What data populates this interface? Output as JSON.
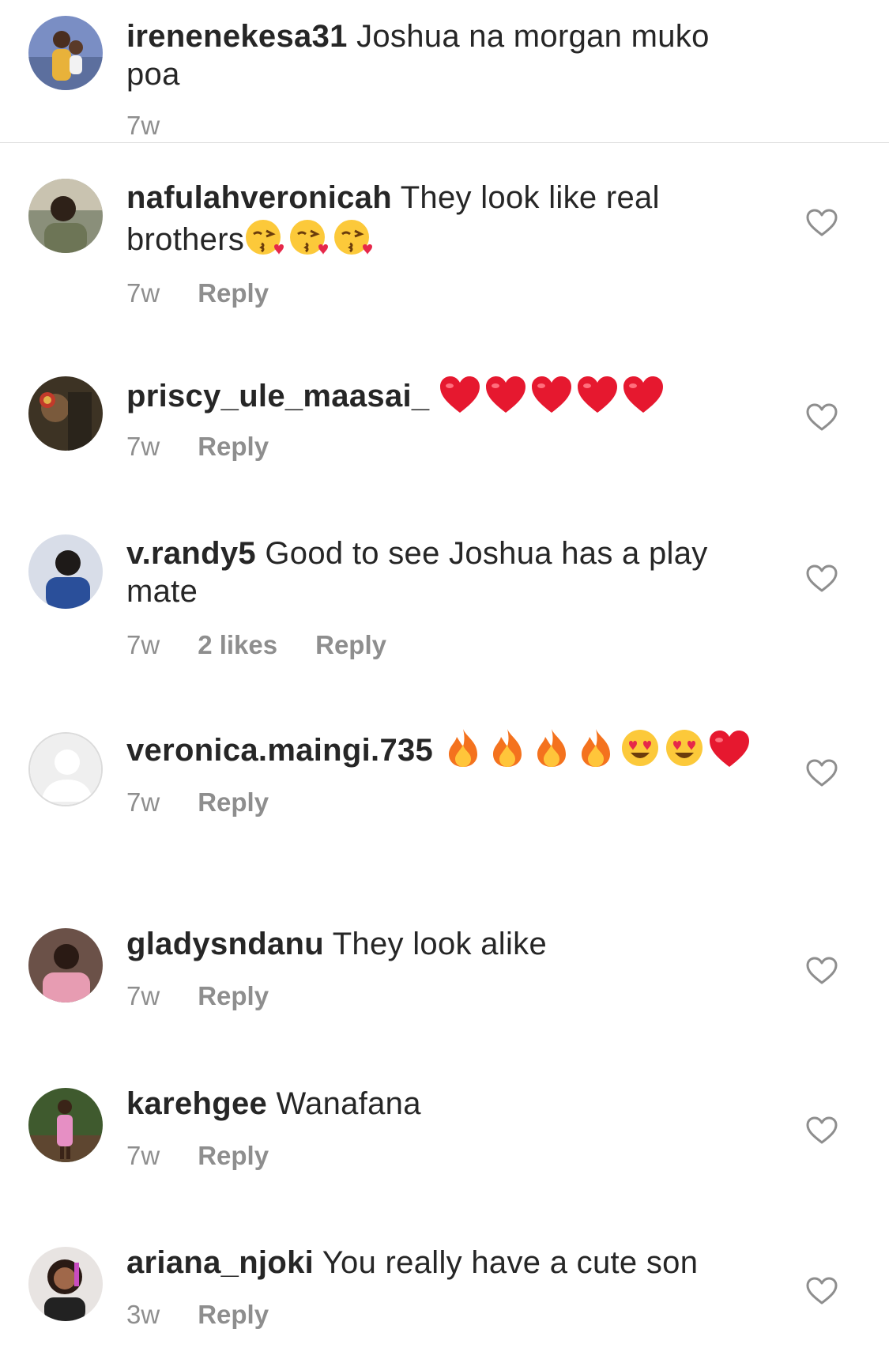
{
  "caption": {
    "username": "irenenekesa31",
    "text": " Joshua na morgan muko poa",
    "time": "7w"
  },
  "comments": [
    {
      "username": "nafulahveronicah",
      "text": " They look like real brothers",
      "emojis": [
        "kissing-heart-emoji",
        "kissing-heart-emoji",
        "kissing-heart-emoji"
      ],
      "time": "7w",
      "likes": "",
      "reply": "Reply"
    },
    {
      "username": "priscy_ule_maasai_",
      "text": " ",
      "emojis": [
        "red-heart-emoji",
        "red-heart-emoji",
        "red-heart-emoji",
        "red-heart-emoji",
        "red-heart-emoji"
      ],
      "time": "7w",
      "likes": "",
      "reply": "Reply"
    },
    {
      "username": "v.randy5",
      "text": " Good to see Joshua has a play mate",
      "emojis": [],
      "time": "7w",
      "likes": "2 likes",
      "reply": "Reply"
    },
    {
      "username": "veronica.maingi.735",
      "text": " ",
      "emojis": [
        "fire-emoji",
        "fire-emoji",
        "fire-emoji",
        "fire-emoji",
        "heart-eyes-emoji",
        "heart-eyes-emoji",
        "red-heart-emoji"
      ],
      "time": "7w",
      "likes": "",
      "reply": "Reply"
    },
    {
      "username": "gladysndanu",
      "text": " They look alike",
      "emojis": [],
      "time": "7w",
      "likes": "",
      "reply": "Reply"
    },
    {
      "username": "karehgee",
      "text": " Wanafana",
      "emojis": [],
      "time": "7w",
      "likes": "",
      "reply": "Reply"
    },
    {
      "username": "ariana_njoki",
      "text": " You really have a cute son",
      "emojis": [],
      "time": "3w",
      "likes": "",
      "reply": "Reply"
    }
  ],
  "colors": {
    "text": "#262626",
    "meta": "#8e8e8e",
    "divider": "#dbdbdb"
  }
}
